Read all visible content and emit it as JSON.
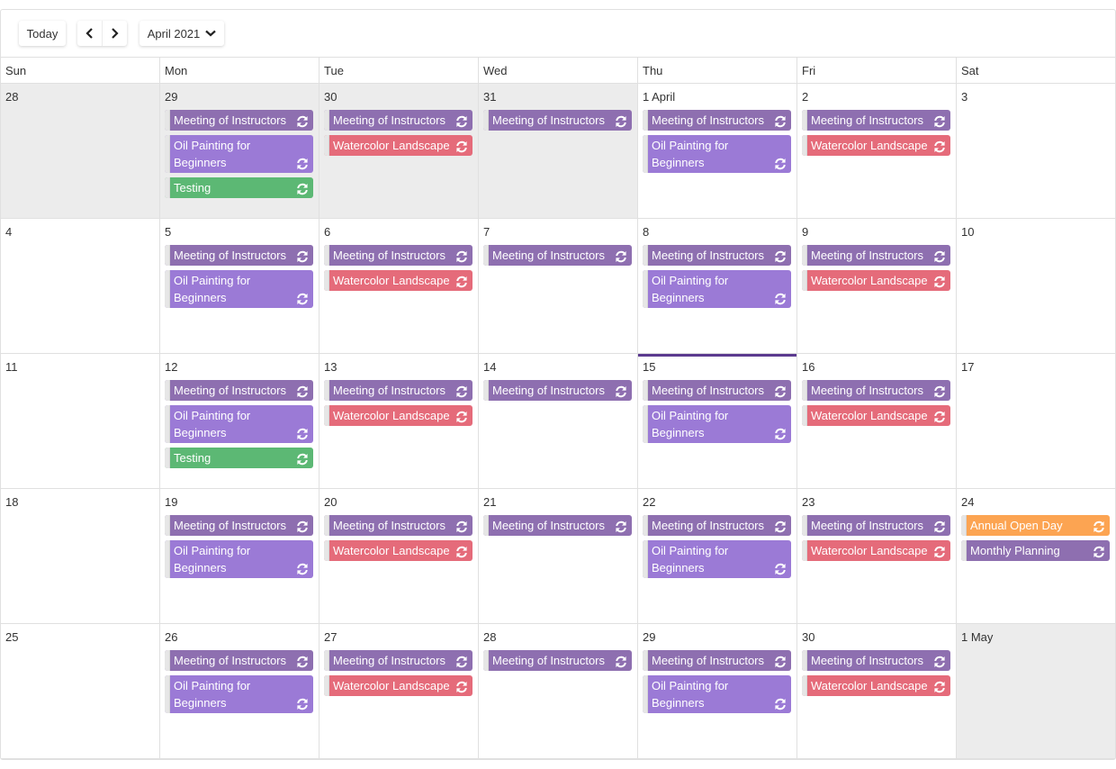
{
  "toolbar": {
    "today_label": "Today",
    "prev_icon": "chevron-left-icon",
    "next_icon": "chevron-right-icon",
    "month_label": "April 2021",
    "month_dropdown_icon": "chevron-down-icon"
  },
  "weekdays": [
    "Sun",
    "Mon",
    "Tue",
    "Wed",
    "Thu",
    "Fri",
    "Sat"
  ],
  "event_colors": {
    "meeting": "#8e6fb0",
    "oil": "#9b7ad6",
    "testing": "#5cb874",
    "water": "#e56b7a",
    "annual": "#fca452",
    "monthly": "#8e6fb0"
  },
  "recurrence_icon": "recurrence-icon",
  "weeks": [
    [
      {
        "label": "28",
        "other": true,
        "events": []
      },
      {
        "label": "29",
        "other": true,
        "events": [
          {
            "title": "Meeting of Instructors",
            "type": "meeting"
          },
          {
            "title": "Oil Painting for Beginners",
            "type": "oil"
          },
          {
            "title": "Testing",
            "type": "testing"
          }
        ]
      },
      {
        "label": "30",
        "other": true,
        "events": [
          {
            "title": "Meeting of Instructors",
            "type": "meeting"
          },
          {
            "title": "Watercolor Landscape",
            "type": "water"
          }
        ]
      },
      {
        "label": "31",
        "other": true,
        "events": [
          {
            "title": "Meeting of Instructors",
            "type": "meeting"
          }
        ]
      },
      {
        "label": "1 April",
        "events": [
          {
            "title": "Meeting of Instructors",
            "type": "meeting"
          },
          {
            "title": "Oil Painting for Beginners",
            "type": "oil"
          }
        ]
      },
      {
        "label": "2",
        "events": [
          {
            "title": "Meeting of Instructors",
            "type": "meeting"
          },
          {
            "title": "Watercolor Landscape",
            "type": "water"
          }
        ]
      },
      {
        "label": "3",
        "events": []
      }
    ],
    [
      {
        "label": "4",
        "events": []
      },
      {
        "label": "5",
        "events": [
          {
            "title": "Meeting of Instructors",
            "type": "meeting"
          },
          {
            "title": "Oil Painting for Beginners",
            "type": "oil"
          }
        ]
      },
      {
        "label": "6",
        "events": [
          {
            "title": "Meeting of Instructors",
            "type": "meeting"
          },
          {
            "title": "Watercolor Landscape",
            "type": "water"
          }
        ]
      },
      {
        "label": "7",
        "events": [
          {
            "title": "Meeting of Instructors",
            "type": "meeting"
          }
        ]
      },
      {
        "label": "8",
        "events": [
          {
            "title": "Meeting of Instructors",
            "type": "meeting"
          },
          {
            "title": "Oil Painting for Beginners",
            "type": "oil"
          }
        ]
      },
      {
        "label": "9",
        "events": [
          {
            "title": "Meeting of Instructors",
            "type": "meeting"
          },
          {
            "title": "Watercolor Landscape",
            "type": "water"
          }
        ]
      },
      {
        "label": "10",
        "events": []
      }
    ],
    [
      {
        "label": "11",
        "events": []
      },
      {
        "label": "12",
        "events": [
          {
            "title": "Meeting of Instructors",
            "type": "meeting"
          },
          {
            "title": "Oil Painting for Beginners",
            "type": "oil"
          },
          {
            "title": "Testing",
            "type": "testing"
          }
        ]
      },
      {
        "label": "13",
        "events": [
          {
            "title": "Meeting of Instructors",
            "type": "meeting"
          },
          {
            "title": "Watercolor Landscape",
            "type": "water"
          }
        ]
      },
      {
        "label": "14",
        "events": [
          {
            "title": "Meeting of Instructors",
            "type": "meeting"
          }
        ]
      },
      {
        "label": "15",
        "today": true,
        "events": [
          {
            "title": "Meeting of Instructors",
            "type": "meeting"
          },
          {
            "title": "Oil Painting for Beginners",
            "type": "oil"
          }
        ]
      },
      {
        "label": "16",
        "events": [
          {
            "title": "Meeting of Instructors",
            "type": "meeting"
          },
          {
            "title": "Watercolor Landscape",
            "type": "water"
          }
        ]
      },
      {
        "label": "17",
        "events": []
      }
    ],
    [
      {
        "label": "18",
        "events": []
      },
      {
        "label": "19",
        "events": [
          {
            "title": "Meeting of Instructors",
            "type": "meeting"
          },
          {
            "title": "Oil Painting for Beginners",
            "type": "oil"
          }
        ]
      },
      {
        "label": "20",
        "events": [
          {
            "title": "Meeting of Instructors",
            "type": "meeting"
          },
          {
            "title": "Watercolor Landscape",
            "type": "water"
          }
        ]
      },
      {
        "label": "21",
        "events": [
          {
            "title": "Meeting of Instructors",
            "type": "meeting"
          }
        ]
      },
      {
        "label": "22",
        "events": [
          {
            "title": "Meeting of Instructors",
            "type": "meeting"
          },
          {
            "title": "Oil Painting for Beginners",
            "type": "oil"
          }
        ]
      },
      {
        "label": "23",
        "events": [
          {
            "title": "Meeting of Instructors",
            "type": "meeting"
          },
          {
            "title": "Watercolor Landscape",
            "type": "water"
          }
        ]
      },
      {
        "label": "24",
        "events": [
          {
            "title": "Annual Open Day",
            "type": "annual"
          },
          {
            "title": "Monthly Planning",
            "type": "monthly"
          }
        ]
      }
    ],
    [
      {
        "label": "25",
        "events": []
      },
      {
        "label": "26",
        "events": [
          {
            "title": "Meeting of Instructors",
            "type": "meeting"
          },
          {
            "title": "Oil Painting for Beginners",
            "type": "oil"
          }
        ]
      },
      {
        "label": "27",
        "events": [
          {
            "title": "Meeting of Instructors",
            "type": "meeting"
          },
          {
            "title": "Watercolor Landscape",
            "type": "water"
          }
        ]
      },
      {
        "label": "28",
        "events": [
          {
            "title": "Meeting of Instructors",
            "type": "meeting"
          }
        ]
      },
      {
        "label": "29",
        "events": [
          {
            "title": "Meeting of Instructors",
            "type": "meeting"
          },
          {
            "title": "Oil Painting for Beginners",
            "type": "oil"
          }
        ]
      },
      {
        "label": "30",
        "events": [
          {
            "title": "Meeting of Instructors",
            "type": "meeting"
          },
          {
            "title": "Watercolor Landscape",
            "type": "water"
          }
        ]
      },
      {
        "label": "1 May",
        "other": true,
        "events": []
      }
    ]
  ]
}
